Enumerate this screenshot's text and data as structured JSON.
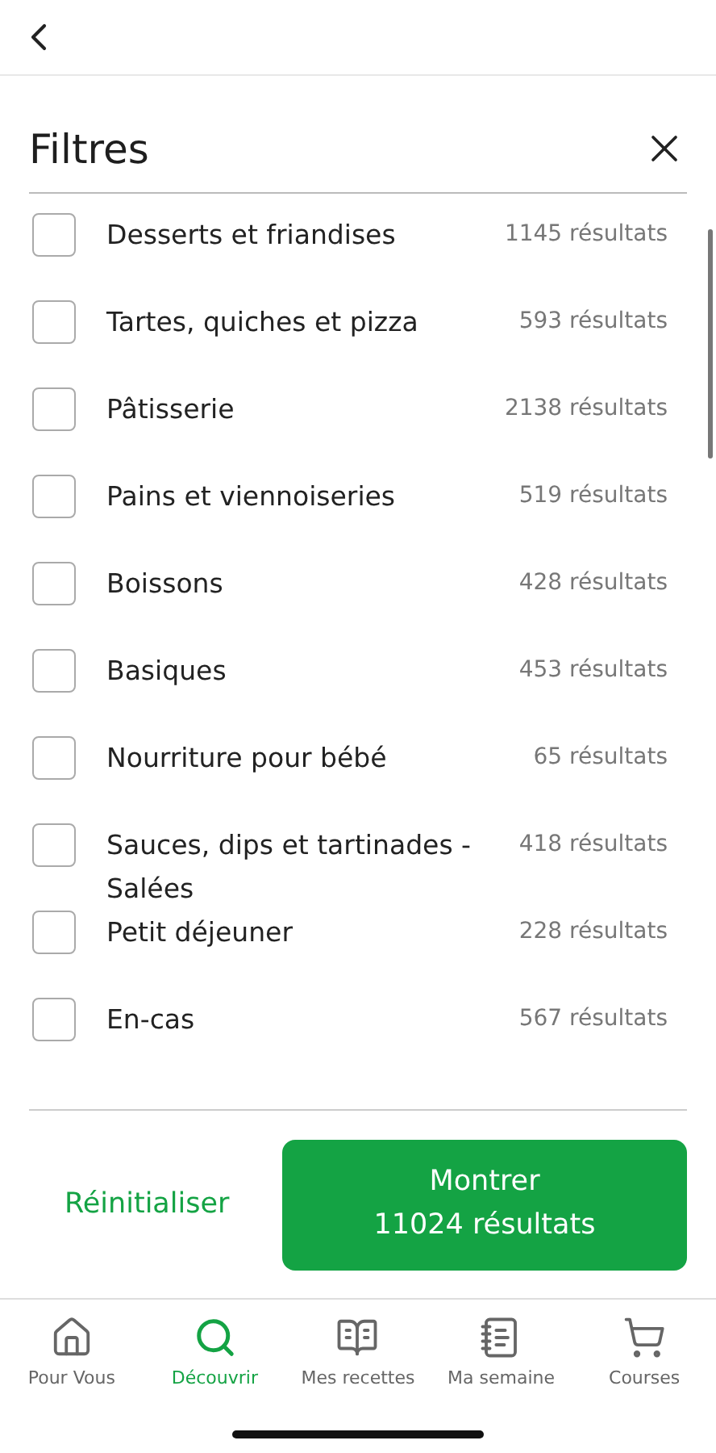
{
  "title": "Filtres",
  "filters": [
    {
      "label": "Desserts et friandises",
      "count": "1145 résultats",
      "checked": false
    },
    {
      "label": "Tartes, quiches et pizza",
      "count": "593 résultats",
      "checked": false
    },
    {
      "label": "Pâtisserie",
      "count": "2138 résultats",
      "checked": false
    },
    {
      "label": "Pains et viennoiseries",
      "count": "519 résultats",
      "checked": false
    },
    {
      "label": "Boissons",
      "count": "428 résultats",
      "checked": false
    },
    {
      "label": "Basiques",
      "count": "453 résultats",
      "checked": false
    },
    {
      "label": "Nourriture pour bébé",
      "count": "65 résultats",
      "checked": false
    },
    {
      "label": "Sauces, dips et tartinades - Salées",
      "count": "418 résultats",
      "checked": false
    },
    {
      "label": "Petit déjeuner",
      "count": "228 résultats",
      "checked": false
    },
    {
      "label": "En-cas",
      "count": "567 résultats",
      "checked": false
    }
  ],
  "reset_button": "Réinitialiser",
  "show_button": {
    "line_1": "Montrer",
    "line_2": "11024 résultats"
  },
  "tab_bar": [
    {
      "kind": "home",
      "label": "Pour Vous",
      "selected": false
    },
    {
      "kind": "search",
      "label": "Découvrir",
      "selected": true
    },
    {
      "kind": "book",
      "label": "Mes recettes",
      "selected": false
    },
    {
      "kind": "planner",
      "label": "Ma semaine",
      "selected": false
    },
    {
      "kind": "cart",
      "label": "Courses",
      "selected": false
    }
  ]
}
